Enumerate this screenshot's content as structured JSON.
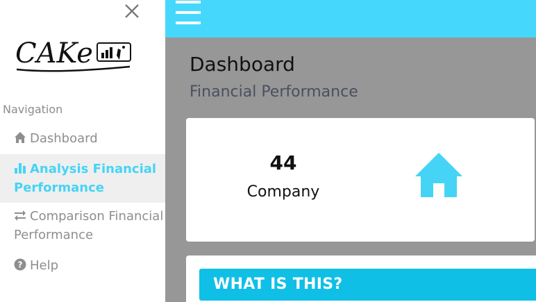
{
  "sidebar": {
    "logo_text": "CAKe",
    "nav_heading": "Navigation",
    "items": [
      {
        "label": "Dashboard",
        "icon": "home-icon"
      },
      {
        "label": "Analysis Financial Performance",
        "icon": "bar-chart-icon",
        "active": true
      },
      {
        "label": "Comparison Financial Performance",
        "icon": "exchange-icon"
      },
      {
        "label": "Help",
        "icon": "question-circle-icon"
      }
    ]
  },
  "header": {
    "menu_icon": "hamburger-icon",
    "color": "#45d8fc"
  },
  "main": {
    "title": "Dashboard",
    "subtitle": "Financial Performance",
    "stat": {
      "value": "44",
      "label": "Company",
      "icon": "home-icon"
    },
    "info_banner": "WHAT IS THIS?"
  },
  "colors": {
    "accent": "#45d4f5",
    "banner": "#10bfe6",
    "page_bg": "#979797"
  }
}
